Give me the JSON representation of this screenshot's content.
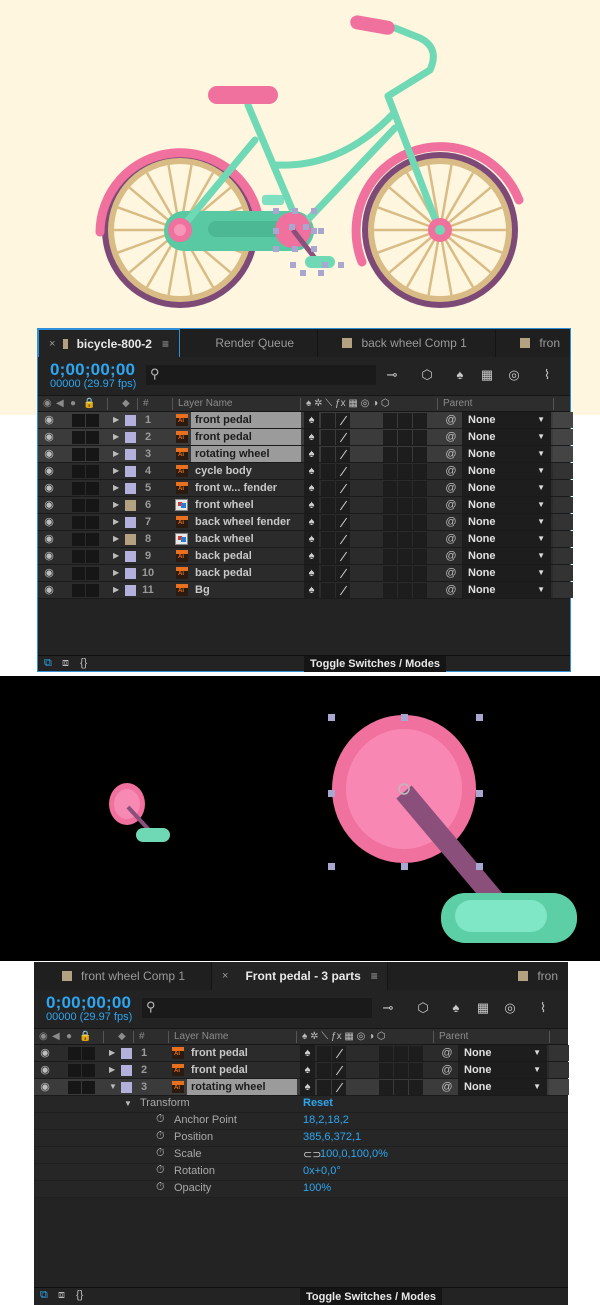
{
  "colors": {
    "accent_blue": "#2ea6ef",
    "bike_bg": "#fef6de",
    "frame_mint": "#6fd8b5",
    "pink": "#f0709e",
    "tire_purple": "#7d4a78",
    "spoke_tan": "#d9bc85",
    "label_lavender": "#b3b0dc",
    "label_sandstone": "#b3a181",
    "panel_bg": "#232323"
  },
  "panel1": {
    "tabs": [
      {
        "label": "bicycle-800-2",
        "active": true,
        "close": "×",
        "menu": "≡"
      },
      {
        "label": "Render Queue",
        "active": false
      },
      {
        "label": "back wheel Comp 1",
        "active": false
      },
      {
        "label": "fron",
        "active": false
      }
    ],
    "timecode": "0;00;00;00",
    "fps": "00000 (29.97 fps)",
    "search_placeholder": "",
    "toolbar_icons": [
      "comp-flowchart-icon",
      "draft-3d-icon",
      "shy-layers-icon",
      "frame-blending-icon",
      "motion-blur-icon",
      "graph-editor-icon"
    ],
    "columns": {
      "number": "#",
      "layer_name": "Layer Name",
      "parent": "Parent"
    },
    "layers": [
      {
        "num": "1",
        "name": "front pedal",
        "type": "ai",
        "label": "lavender",
        "selected": true,
        "parent": "None"
      },
      {
        "num": "2",
        "name": "front pedal",
        "type": "ai",
        "label": "lavender",
        "selected": true,
        "parent": "None"
      },
      {
        "num": "3",
        "name": "rotating wheel",
        "type": "ai",
        "label": "lavender",
        "selected": true,
        "parent": "None"
      },
      {
        "num": "4",
        "name": "cycle body",
        "type": "ai",
        "label": "lavender",
        "selected": false,
        "parent": "None"
      },
      {
        "num": "5",
        "name": "front w... fender",
        "type": "ai",
        "label": "lavender",
        "selected": false,
        "parent": "None"
      },
      {
        "num": "6",
        "name": "front wheel",
        "type": "comp",
        "label": "sandstone",
        "selected": false,
        "parent": "None"
      },
      {
        "num": "7",
        "name": "back wheel fender",
        "type": "ai",
        "label": "lavender",
        "selected": false,
        "parent": "None"
      },
      {
        "num": "8",
        "name": "back wheel",
        "type": "comp",
        "label": "sandstone",
        "selected": false,
        "parent": "None"
      },
      {
        "num": "9",
        "name": "back pedal",
        "type": "ai",
        "label": "lavender",
        "selected": false,
        "parent": "None"
      },
      {
        "num": "10",
        "name": "back pedal",
        "type": "ai",
        "label": "lavender",
        "selected": false,
        "parent": "None"
      },
      {
        "num": "11",
        "name": "Bg",
        "type": "ai",
        "label": "lavender",
        "selected": false,
        "parent": "None"
      }
    ],
    "footer_toggle": "Toggle Switches / Modes"
  },
  "panel2": {
    "tabs": [
      {
        "label": "front wheel Comp 1",
        "active": false
      },
      {
        "label": "Front pedal - 3 parts",
        "active": true,
        "close": "×",
        "menu": "≡"
      },
      {
        "label": "fron",
        "active": false
      }
    ],
    "timecode": "0;00;00;00",
    "fps": "00000 (29.97 fps)",
    "columns": {
      "number": "#",
      "layer_name": "Layer Name",
      "parent": "Parent"
    },
    "layers": [
      {
        "num": "1",
        "name": "front pedal",
        "type": "ai",
        "label": "lavender",
        "selected": false,
        "expanded": false,
        "parent": "None"
      },
      {
        "num": "2",
        "name": "front pedal",
        "type": "ai",
        "label": "lavender",
        "selected": false,
        "expanded": false,
        "parent": "None"
      },
      {
        "num": "3",
        "name": "rotating wheel",
        "type": "ai",
        "label": "lavender",
        "selected": true,
        "expanded": true,
        "parent": "None"
      }
    ],
    "transform": {
      "label": "Transform",
      "reset": "Reset",
      "properties": [
        {
          "name": "Anchor Point",
          "value": "18,2,18,2"
        },
        {
          "name": "Position",
          "value": "385,6,372,1"
        },
        {
          "name": "Scale",
          "value": "100,0,100,0%",
          "linked": true
        },
        {
          "name": "Rotation",
          "value": "0x+0,0°"
        },
        {
          "name": "Opacity",
          "value": "100%"
        }
      ]
    },
    "footer_toggle": "Toggle Switches / Modes"
  }
}
